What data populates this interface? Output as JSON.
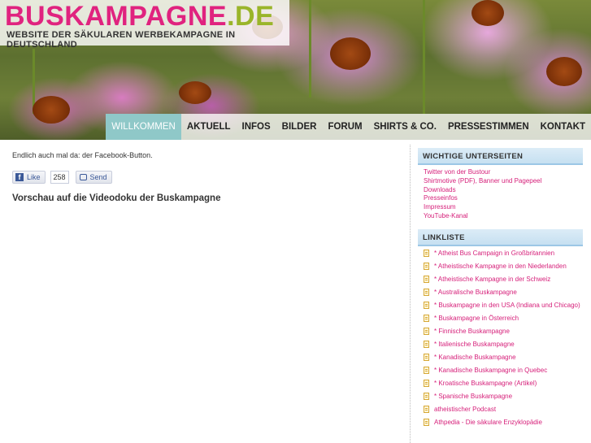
{
  "header": {
    "logo_main": "BUSKAMPAGNE",
    "logo_tld": ".DE",
    "logo_subtitle": "WEBSITE DER SÄKULAREN WERBEKAMPAGNE IN DEUTSCHLAND"
  },
  "nav": {
    "items": [
      {
        "label": "WILLKOMMEN",
        "active": true
      },
      {
        "label": "AKTUELL"
      },
      {
        "label": "INFOS"
      },
      {
        "label": "BILDER"
      },
      {
        "label": "FORUM"
      },
      {
        "label": "SHIRTS & CO."
      },
      {
        "label": "PRESSESTIMMEN"
      },
      {
        "label": "KONTAKT"
      }
    ]
  },
  "main": {
    "intro": "Endlich auch mal da: der Facebook-Button.",
    "like_label": "Like",
    "like_count": "258",
    "send_label": "Send",
    "post_title": "Vorschau auf die Videodoku der Buskampagne"
  },
  "sidebar": {
    "important_title": "WICHTIGE UNTERSEITEN",
    "important_links": [
      "Twitter von der Bustour",
      "Shirtmotive (PDF), Banner und Pagepeel",
      "Downloads",
      "Presseinfos",
      "Impressum",
      "YouTube-Kanal"
    ],
    "links_title": "LINKLISTE",
    "links": [
      "* Atheist Bus Campaign in Großbritannien",
      "* Atheistische Kampagne in den Niederlanden",
      "* Atheistische Kampagne in der Schweiz",
      "* Australische Buskampagne",
      "* Buskampagne in den USA (Indiana und Chicago)",
      "* Buskampagne in Österreich",
      "* Finnische Buskampagne",
      "* Italienische Buskampagne",
      "* Kanadische Buskampagne",
      "* Kanadische Buskampagne in Quebec",
      "* Kroatische Buskampagne (Artikel)",
      "* Spanische Buskampagne",
      "atheistischer Podcast",
      "Athpedia - Die säkulare Enzyklopädie"
    ]
  },
  "colors": {
    "brand_pink": "#e0237f",
    "brand_green": "#9ab52a",
    "nav_active": "#8fc8c8",
    "link_color": "#d6207a"
  }
}
